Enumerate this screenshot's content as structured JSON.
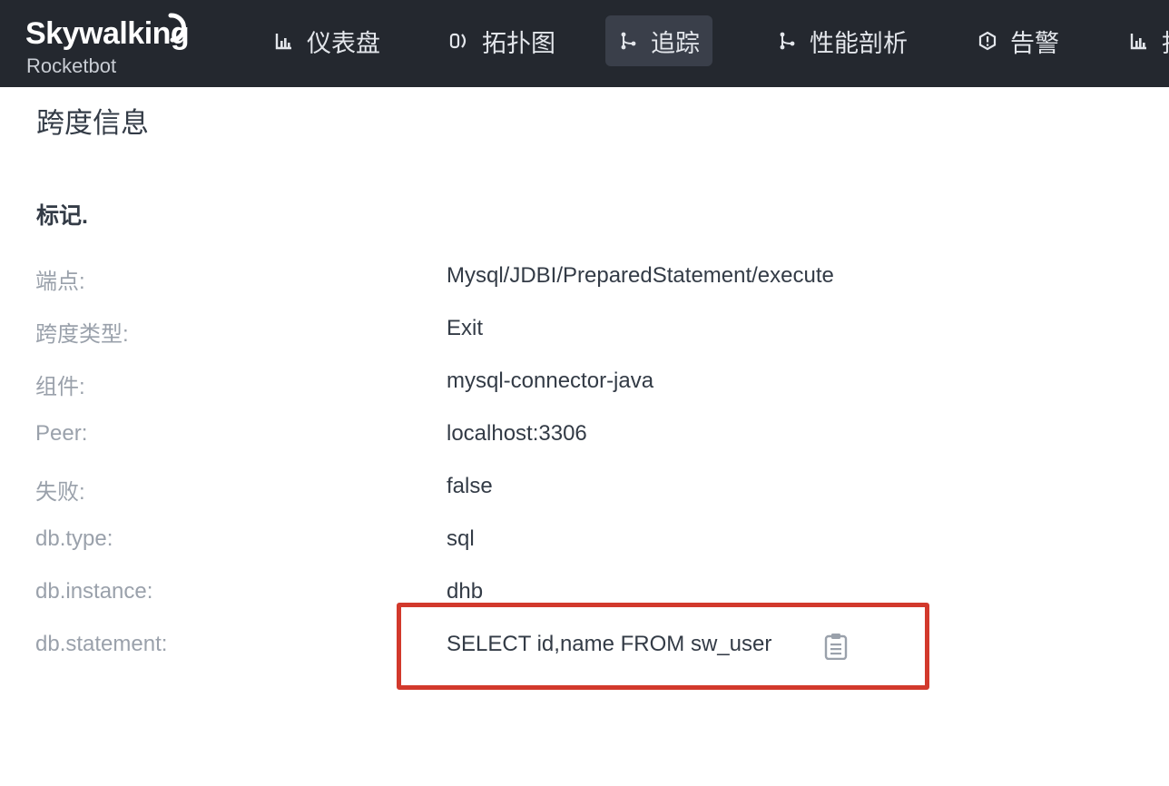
{
  "brand": {
    "name": "Skywalking",
    "subtitle": "Rocketbot"
  },
  "nav": [
    {
      "label": "仪表盘",
      "icon": "bar-chart-icon",
      "active": false
    },
    {
      "label": "拓扑图",
      "icon": "topology-icon",
      "active": false
    },
    {
      "label": "追踪",
      "icon": "trace-branch-icon",
      "active": true
    },
    {
      "label": "性能剖析",
      "icon": "profile-branch-icon",
      "active": false
    },
    {
      "label": "告警",
      "icon": "alarm-icon",
      "active": false
    },
    {
      "label": "指",
      "icon": "bar-chart-icon",
      "active": false
    }
  ],
  "page": {
    "title": "跨度信息",
    "subtitle": "标记."
  },
  "details": [
    {
      "key": "端点:",
      "value": "Mysql/JDBI/PreparedStatement/execute"
    },
    {
      "key": "跨度类型:",
      "value": "Exit"
    },
    {
      "key": "组件:",
      "value": "mysql-connector-java"
    },
    {
      "key": "Peer:",
      "value": "localhost:3306"
    },
    {
      "key": "失败:",
      "value": "false"
    },
    {
      "key": "db.type:",
      "value": "sql"
    },
    {
      "key": "db.instance:",
      "value": "dhb"
    },
    {
      "key": "db.statement:",
      "value": "SELECT id,name FROM sw_user"
    }
  ],
  "colors": {
    "topbar": "#24282f",
    "highlight": "#d2392c",
    "key_text": "#9aa1ab",
    "value_text": "#333b46"
  }
}
